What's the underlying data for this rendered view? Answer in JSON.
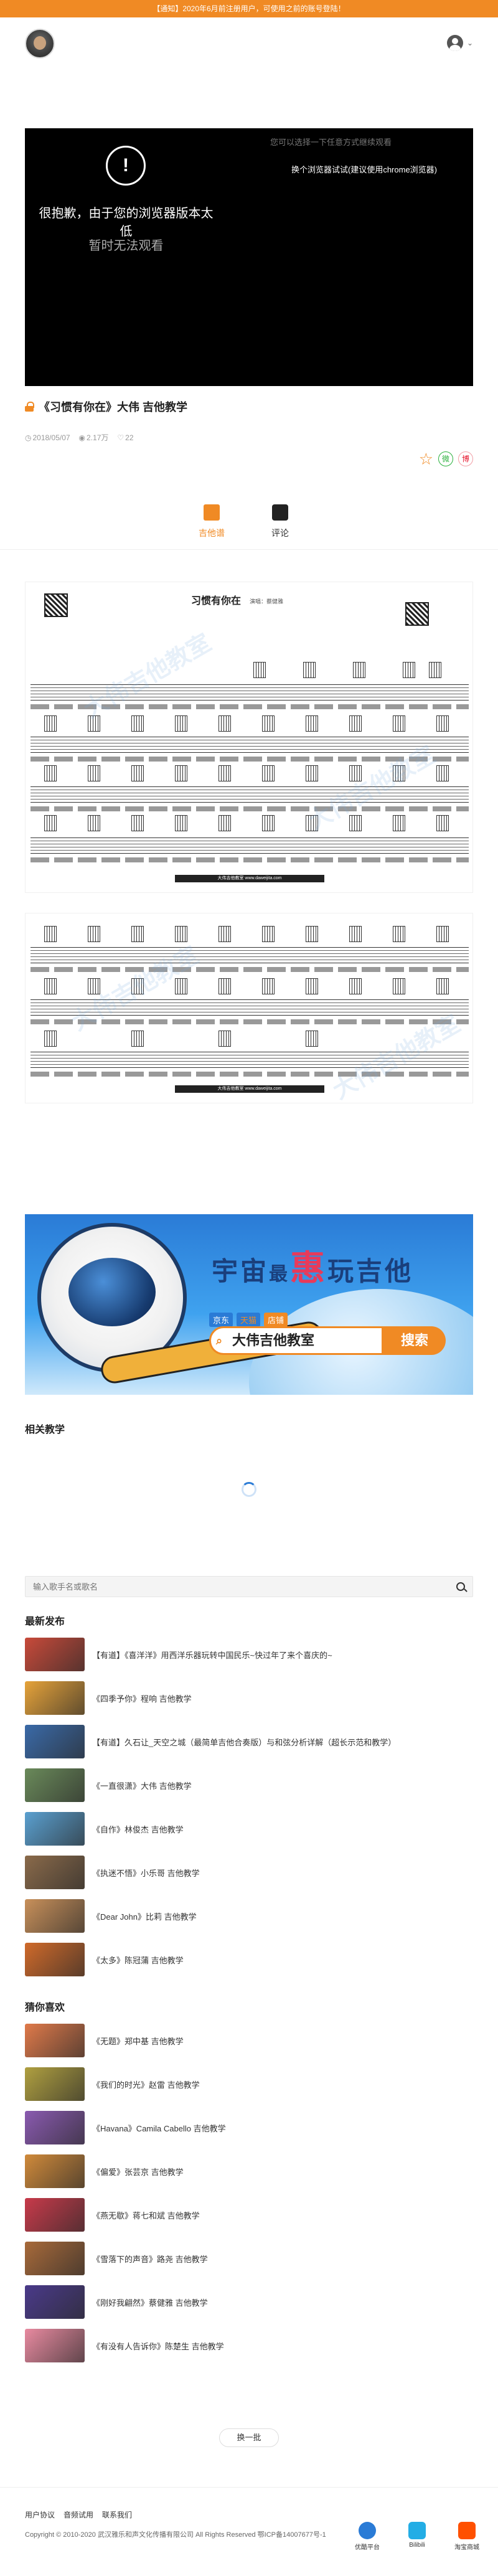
{
  "notice": {
    "text": "【通知】2020年6月前注册用户，可使用之前的账号登陆！"
  },
  "header": {
    "user_icon": "user-icon",
    "chevron": "⌄"
  },
  "video": {
    "hint_top": "您可以选择一下任意方式继续观看",
    "hint_browser": "换个浏览器试试(建议使用chrome浏览器)",
    "warning_mark": "!",
    "error_title": "很抱歉，由于您的浏览器版本太低",
    "error_sub": "暂时无法观看"
  },
  "lesson": {
    "title": "《习惯有你在》大伟 吉他教学",
    "date": "2018/05/07",
    "views": "2.17万",
    "likes": "22"
  },
  "share": {
    "wechat": "微",
    "weibo": "博"
  },
  "tabs": [
    {
      "label": "吉他谱",
      "active": true
    },
    {
      "label": "评论",
      "active": false
    }
  ],
  "sheet": {
    "title": "习惯有你在",
    "author": "演唱：蔡健雅",
    "footer": "大伟吉他教室 www.daweijita.com"
  },
  "watermark": "大伟吉他教室",
  "ad": {
    "slogan_a": "宇宙",
    "slogan_b": "最",
    "slogan_c": "惠",
    "slogan_d": "玩吉他",
    "tag1": "京东",
    "tag2": "天猫",
    "tag3": "店铺",
    "search_text": "大伟吉他教室",
    "search_button": "搜索"
  },
  "related": {
    "title": "相关教学"
  },
  "singer_search": {
    "placeholder": "输入歌手名或歌名"
  },
  "latest": {
    "title": "最新发布",
    "items": [
      {
        "label": "【有道】《喜洋洋》用西洋乐器玩转中国民乐~快过年了来个喜庆的~"
      },
      {
        "label": "《四季予你》程响 吉他教学"
      },
      {
        "label": "【有道】久石让_天空之城（最简单吉他合奏版）与和弦分析详解（超长示范和教学）"
      },
      {
        "label": "《一直很潇》大伟 吉他教学"
      },
      {
        "label": "《自作》林俊杰 吉他教学"
      },
      {
        "label": "《执迷不悟》小乐哥 吉他教学"
      },
      {
        "label": "《Dear John》比莉 吉他教学"
      },
      {
        "label": "《太多》陈冠蒲 吉他教学"
      }
    ]
  },
  "guess": {
    "title": "猜你喜欢",
    "items": [
      {
        "label": "《无题》郑中基 吉他教学"
      },
      {
        "label": "《我们的时光》赵雷 吉他教学"
      },
      {
        "label": "《Havana》Camila Cabello 吉他教学"
      },
      {
        "label": "《偏爱》张芸京 吉他教学"
      },
      {
        "label": "《燕无歇》蒋七和斌 吉他教学"
      },
      {
        "label": "《雪落下的声音》路尧 吉他教学"
      },
      {
        "label": "《刚好我翩然》蔡健雅 吉他教学"
      },
      {
        "label": "《有没有人告诉你》陈楚生 吉他教学"
      }
    ]
  },
  "more_button": "换一批",
  "footer": {
    "links": [
      "用户协议",
      "音频试用",
      "联系我们"
    ],
    "copyright": "Copyright © 2010-2020 武汉雅乐和声文化传播有限公司 All Rights Reserved    鄂ICP备14007677号-1",
    "platforms": [
      {
        "label": "优酷平台"
      },
      {
        "label": "Bilibili"
      },
      {
        "label": "淘宝商城"
      }
    ]
  },
  "colors": {
    "accent": "#f08a24",
    "ad_blue": "#2a7bd6"
  },
  "thumb_colors": {
    "latest": [
      "#c84a3a",
      "#e6a33a",
      "#3a6aa8",
      "#6a8a5a",
      "#5aa0d0",
      "#8a6a4a",
      "#c8905a",
      "#d06a2a"
    ],
    "guess": [
      "#e07a4a",
      "#b0a040",
      "#8a5ab0",
      "#d08a3a",
      "#c83a4a",
      "#a86a3a",
      "#4a3a8a",
      "#e88aa0"
    ]
  }
}
